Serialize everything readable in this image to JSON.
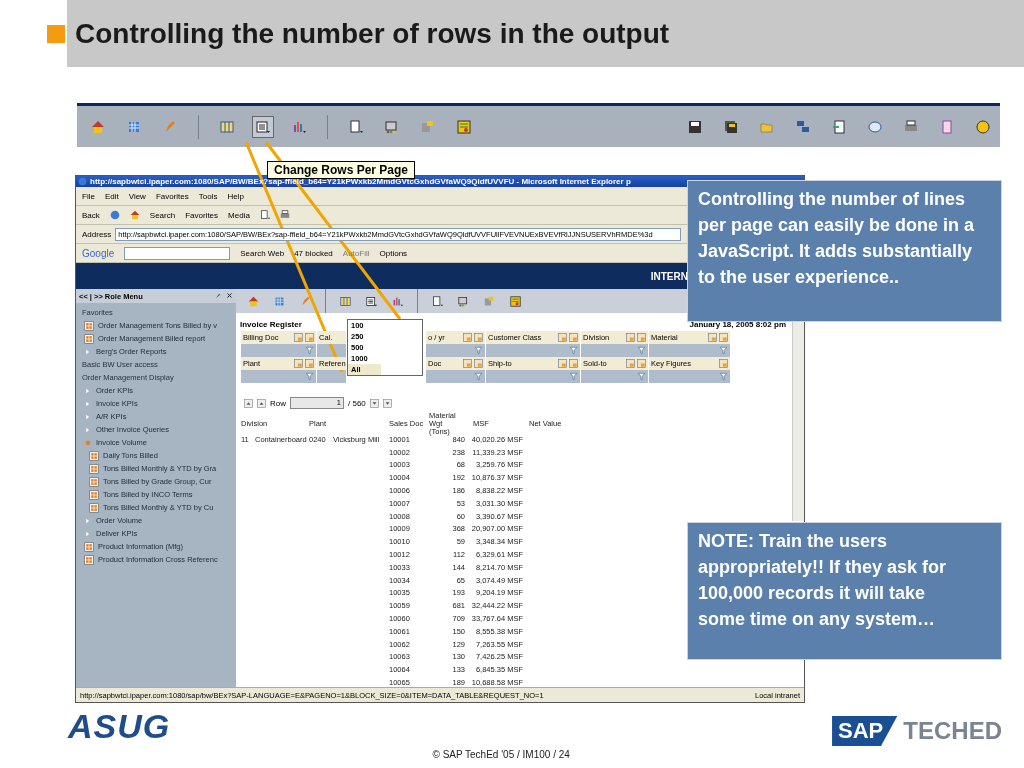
{
  "slide": {
    "title": "Controlling the number of rows in the output"
  },
  "tooltip": "Change Rows Per Page",
  "browser": {
    "title": "http://sapbwtci.ipaper.com:1080/SAP/BW/BEx?sap-ffield_b64=Y21kPWxkb2MmdGVtcGxhdGVfaWQ9QldfUVVFU - Microsoft Internet Explorer p",
    "menu": [
      "File",
      "Edit",
      "View",
      "Favorites",
      "Tools",
      "Help"
    ],
    "toolbar": {
      "back": "Back",
      "search": "Search",
      "favorites": "Favorites",
      "media": "Media"
    },
    "address": {
      "label": "Address",
      "url": "http://sapbwtci.ipaper.com:1080/SAP/BW/BEx?sap-ffield_b64=Y21kPWxkb2MmdGVtcGxhdGVfaWQ9QldfUVVFUllFVEVNUExBVEVfRlJJNSUSERVhRMDE%3d"
    },
    "google_bar": {
      "logo": "Google",
      "search": "Search Web",
      "blocked": "47 blocked",
      "autofill": "AutoFill",
      "options": "Options"
    },
    "banner": "INTERN",
    "status": {
      "url": "http://sapbwtci.ipaper.com:1080/sap/bw/BEx?SAP-LANGUAGE=E&PAGENO=1&BLOCK_SIZE=0&ITEM=DATA_TABLE&REQUEST_NO=1",
      "zone": "Local intranet"
    }
  },
  "sidebar": {
    "title": "<< | >> Role Menu",
    "items": [
      {
        "label": "Favorites",
        "kind": "heading",
        "children": [
          {
            "label": "Order Management Tons Billed by v",
            "kind": "report"
          },
          {
            "label": "Order Management Billed report",
            "kind": "report"
          },
          {
            "label": "Berg's Order Reports",
            "kind": "folder",
            "expanded": false
          }
        ]
      },
      {
        "label": "Basic BW User access",
        "kind": "heading"
      },
      {
        "label": "Order Management Display",
        "kind": "heading",
        "children": [
          {
            "label": "Order KPIs",
            "kind": "folder",
            "expanded": false
          },
          {
            "label": "Invoice KPIs",
            "kind": "folder",
            "expanded": false
          },
          {
            "label": "A/R KPIs",
            "kind": "folder",
            "expanded": false
          },
          {
            "label": "Other Invoice Queries",
            "kind": "folder",
            "expanded": false
          },
          {
            "label": "Invoice Volume",
            "kind": "folder",
            "expanded": true,
            "children": [
              {
                "label": "Daily Tons Billed",
                "kind": "report"
              },
              {
                "label": "Tons Billed Monthly & YTD by Gra",
                "kind": "report"
              },
              {
                "label": "Tons Billed by Grade Group, Cur",
                "kind": "report"
              },
              {
                "label": "Tons Billed by INCO Terms",
                "kind": "report"
              },
              {
                "label": "Tons Billed Monthly & YTD by Cu",
                "kind": "report"
              }
            ]
          },
          {
            "label": "Order Volume",
            "kind": "folder",
            "expanded": false
          },
          {
            "label": "Deliver KPIs",
            "kind": "folder",
            "expanded": false
          },
          {
            "label": "Product Information (Mfg)",
            "kind": "report"
          },
          {
            "label": "Product Information Cross Referenc",
            "kind": "report"
          }
        ]
      }
    ]
  },
  "report": {
    "title": "Invoice Register",
    "date": "January 18, 2005 8:02 pm",
    "filters": [
      [
        "Billing Doc",
        "Cal.",
        "o / yr",
        "Customer Class",
        "Division",
        "Material"
      ],
      [
        "Plant",
        "Referen",
        "Doc",
        "Ship-to",
        "Sold-to",
        "Key Figures"
      ]
    ],
    "rows_menu": [
      {
        "label": "100",
        "selected": false
      },
      {
        "label": "250",
        "selected": false
      },
      {
        "label": "500",
        "selected": false
      },
      {
        "label": "1000",
        "selected": false
      },
      {
        "label": "All",
        "selected": true
      }
    ],
    "navigator": {
      "label": "Row",
      "value": "1",
      "total": "/ 560"
    },
    "columns": [
      "Division",
      "Plant",
      "Sales Doc",
      "Material Wgt (Tons)",
      "MSF",
      "Net Value"
    ],
    "rows": [
      {
        "division_code": "11",
        "division": "Containerboard",
        "plant_code": "0240",
        "plant": "Vicksburg Mill",
        "sales_doc": "10001",
        "weight": "840",
        "msf": "40,020.26 MSF"
      },
      {
        "sales_doc": "10002",
        "weight": "238",
        "msf": "11,339.23 MSF"
      },
      {
        "sales_doc": "10003",
        "weight": "68",
        "msf": "3,259.76 MSF"
      },
      {
        "sales_doc": "10004",
        "weight": "192",
        "msf": "10,876.37 MSF"
      },
      {
        "sales_doc": "10006",
        "weight": "186",
        "msf": "8,838.22 MSF"
      },
      {
        "sales_doc": "10007",
        "weight": "53",
        "msf": "3,031.30 MSF"
      },
      {
        "sales_doc": "10008",
        "weight": "60",
        "msf": "3,390.67 MSF"
      },
      {
        "sales_doc": "10009",
        "weight": "368",
        "msf": "20,907.00 MSF"
      },
      {
        "sales_doc": "10010",
        "weight": "59",
        "msf": "3,348.34 MSF"
      },
      {
        "sales_doc": "10012",
        "weight": "112",
        "msf": "6,329.61 MSF"
      },
      {
        "sales_doc": "10033",
        "weight": "144",
        "msf": "8,214.70 MSF"
      },
      {
        "sales_doc": "10034",
        "weight": "65",
        "msf": "3,074.49 MSF"
      },
      {
        "sales_doc": "10035",
        "weight": "193",
        "msf": "9,204.19 MSF"
      },
      {
        "sales_doc": "10059",
        "weight": "681",
        "msf": "32,444.22 MSF"
      },
      {
        "sales_doc": "10060",
        "weight": "709",
        "msf": "33,767.64 MSF"
      },
      {
        "sales_doc": "10061",
        "weight": "150",
        "msf": "8,555.38 MSF"
      },
      {
        "sales_doc": "10062",
        "weight": "129",
        "msf": "7,263.55 MSF"
      },
      {
        "sales_doc": "10063",
        "weight": "130",
        "msf": "7,426.25 MSF"
      },
      {
        "sales_doc": "10064",
        "weight": "133",
        "msf": "6,845.35 MSF"
      },
      {
        "sales_doc": "10065",
        "weight": "189",
        "msf": "10,688.58 MSF"
      }
    ]
  },
  "callouts": [
    "Controlling the number of lines per page can easily be done in a JavaScript. It adds substantially to the user experience..",
    "NOTE: Train the users appropriately!!  If they ask for 100,000 records it will take some time on any system…"
  ],
  "footer": {
    "left_logo": "ASUG",
    "copyright": "© SAP TechEd '05 / IM100 / 24",
    "right_logo_a": "SAP",
    "right_logo_b": "TECHED"
  }
}
